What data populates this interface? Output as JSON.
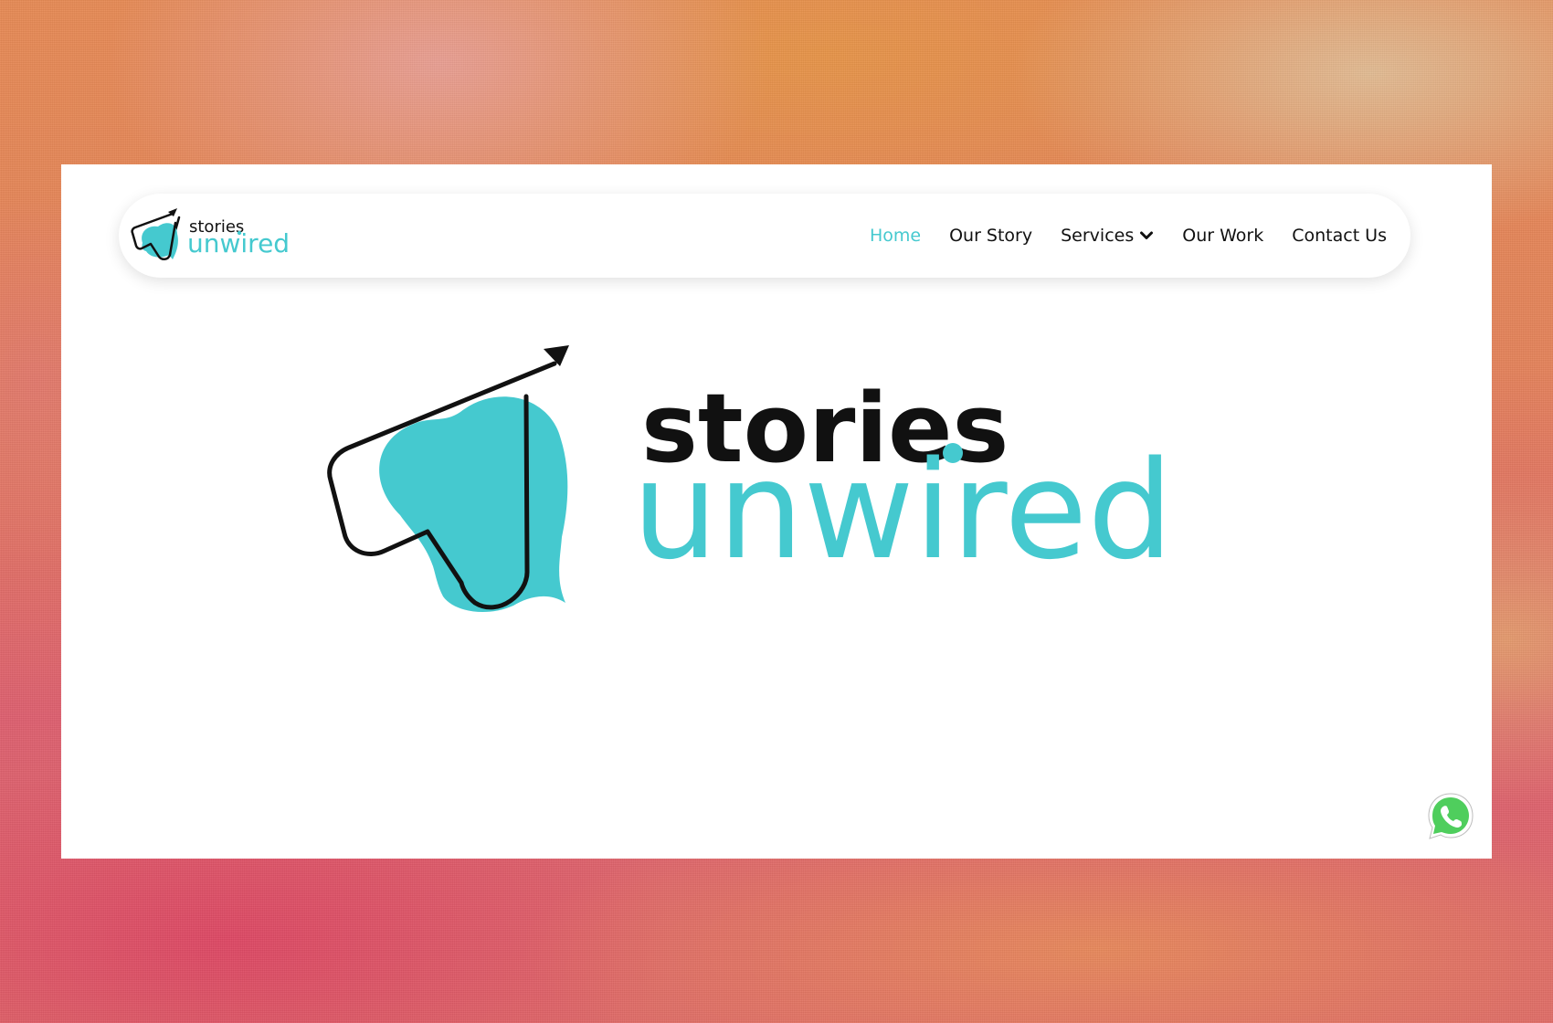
{
  "brand": {
    "name_line1": "stories",
    "name_line2": "unwired",
    "teal_color": "#45c9cf",
    "dark_color": "#111111"
  },
  "nav": {
    "items": [
      {
        "label": "Home",
        "active": true
      },
      {
        "label": "Our Story",
        "active": false
      },
      {
        "label": "Services",
        "active": false,
        "has_dropdown": true
      },
      {
        "label": "Our Work",
        "active": false
      },
      {
        "label": "Contact Us",
        "active": false
      }
    ]
  },
  "floating": {
    "whatsapp_icon": "whatsapp-icon",
    "whatsapp_color": "#4fce5d"
  }
}
